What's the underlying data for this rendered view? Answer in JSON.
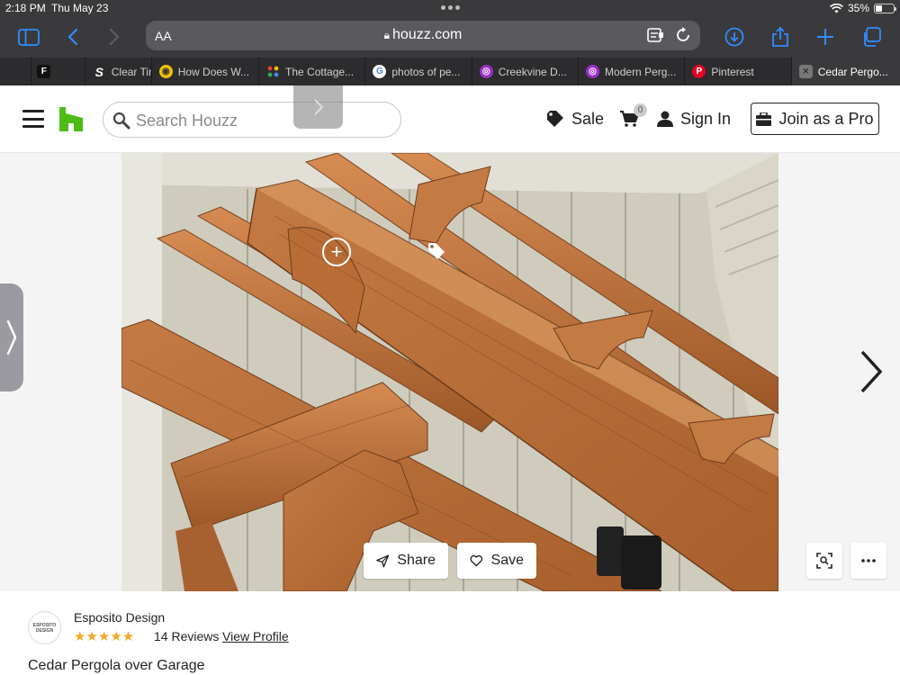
{
  "status_bar": {
    "time": "2:18 PM",
    "date": "Thu May 23",
    "battery": "35%",
    "battery_level": 0.35
  },
  "browser": {
    "text_size_label": "AA",
    "url": "houzz.com",
    "tabs": [
      {
        "label": "",
        "icon": "F",
        "favicon_color": "#111111",
        "active": false
      },
      {
        "label": "Clear Tin",
        "icon": "S",
        "favicon_color": "#1a3fa8",
        "active": false
      },
      {
        "label": "How Does W...",
        "icon": "globe",
        "favicon_color": "#f2c200",
        "active": false
      },
      {
        "label": "The Cottage...",
        "icon": "grid",
        "favicon_color": "#4a90e2",
        "active": false
      },
      {
        "label": "photos of pe...",
        "icon": "G",
        "favicon_color": "#ffffff",
        "active": false
      },
      {
        "label": "Creekvine D...",
        "icon": "target",
        "favicon_color": "#9b30c8",
        "active": false
      },
      {
        "label": "Modern Perg...",
        "icon": "target",
        "favicon_color": "#9b30c8",
        "active": false
      },
      {
        "label": "Pinterest",
        "icon": "P",
        "favicon_color": "#e60023",
        "active": false
      },
      {
        "label": "Cedar Pergo...",
        "icon": "close",
        "favicon_color": "#888888",
        "active": true
      }
    ]
  },
  "header": {
    "search_placeholder": "Search Houzz",
    "sale_label": "Sale",
    "cart_count": "0",
    "sign_in_label": "Sign In",
    "join_label": "Join as a Pro"
  },
  "photo": {
    "share_label": "Share",
    "save_label": "Save",
    "hotspot_symbol": "+"
  },
  "pro": {
    "avatar_text": "ESPOSITO DESIGN",
    "name": "Esposito Design",
    "rating": 5,
    "stars": "★★★★★",
    "reviews": "14 Reviews",
    "view_profile_label": "View Profile"
  },
  "title": "Cedar Pergola over Garage",
  "colors": {
    "safari_accent": "#2f8cff",
    "houzz_green": "#4dbc15",
    "star": "#f5a623"
  }
}
